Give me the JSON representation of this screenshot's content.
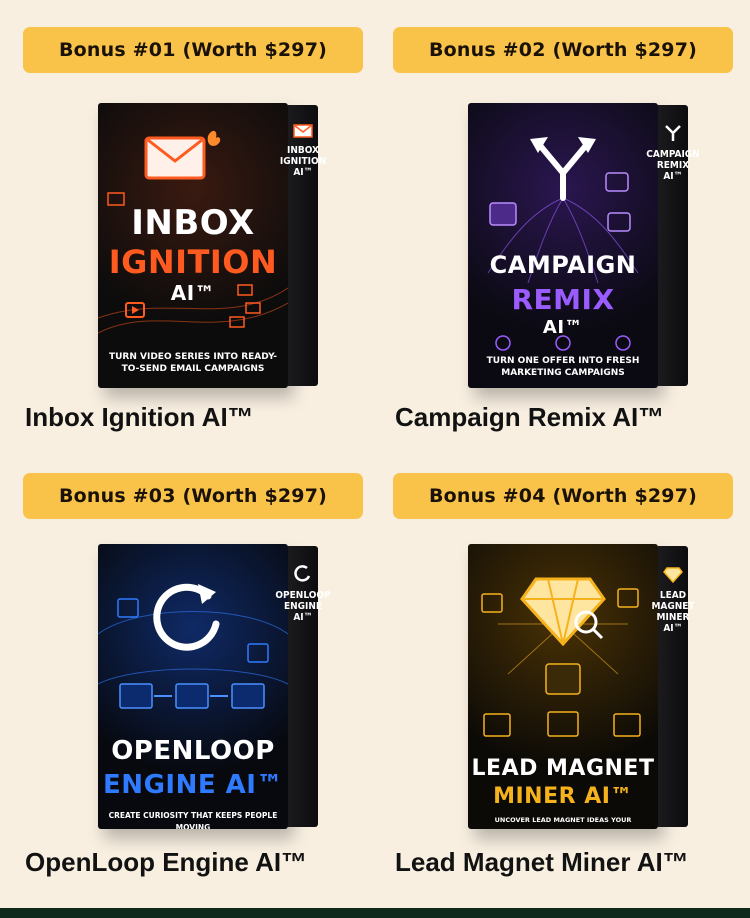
{
  "bonuses": [
    {
      "badge": "Bonus #01 (Worth $297)",
      "name": "Inbox Ignition AI™",
      "box": {
        "line1": "INBOX",
        "line2": "IGNITION",
        "line3": "AI™",
        "tagline": "TURN VIDEO SERIES INTO READY-TO-SEND EMAIL CAMPAIGNS",
        "spine": "INBOX IGNITION AI™",
        "accent": "#ff5a1f",
        "icon": "envelope-icon"
      }
    },
    {
      "badge": "Bonus #02 (Worth $297)",
      "name": "Campaign Remix AI™",
      "box": {
        "line1": "CAMPAIGN",
        "line2": "REMIX",
        "line3": "AI™",
        "tagline": "TURN ONE OFFER INTO FRESH MARKETING CAMPAIGNS",
        "spine": "CAMPAIGN REMIX AI™",
        "accent": "#9b5cff",
        "icon": "split-arrows-icon"
      }
    },
    {
      "badge": "Bonus #03 (Worth $297)",
      "name": "OpenLoop Engine AI™",
      "box": {
        "line1": "OPENLOOP",
        "line2": "ENGINE AI™",
        "tagline": "CREATE CURIOSITY THAT KEEPS PEOPLE MOVING",
        "spine": "OPENLOOP ENGINE AI™",
        "accent": "#2f7bff",
        "icon": "loop-icon"
      }
    },
    {
      "badge": "Bonus #04 (Worth $297)",
      "name": "Lead Magnet Miner AI™",
      "box": {
        "line1": "LEAD MAGNET",
        "line2": "MINER AI™",
        "tagline": "UNCOVER LEAD MAGNET IDEAS YOUR AUDIENCE WANTS",
        "spine": "LEAD MAGNET MINER AI™",
        "accent": "#f5b21c",
        "icon": "diamond-icon"
      }
    }
  ]
}
